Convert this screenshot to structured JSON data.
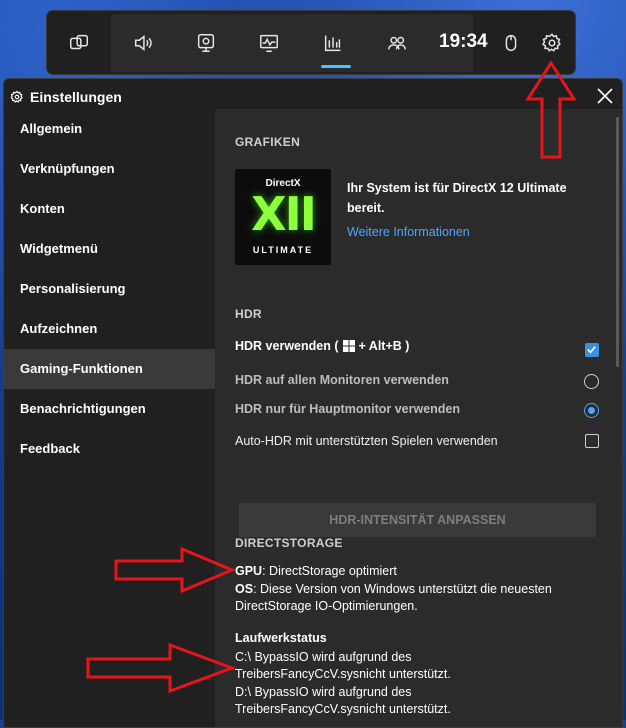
{
  "gamebar": {
    "clock": "19:34",
    "icons": [
      "widget-icon",
      "volume-icon",
      "capture-icon",
      "performance-icon",
      "resources-icon",
      "social-icon",
      "mouse-icon",
      "gear-icon"
    ]
  },
  "window": {
    "title": "Einstellungen",
    "close_label": "✕"
  },
  "nav": {
    "items": [
      "Allgemein",
      "Verknüpfungen",
      "Konten",
      "Widgetmenü",
      "Personalisierung",
      "Aufzeichnen",
      "Gaming-Funktionen",
      "Benachrichtigungen",
      "Feedback"
    ],
    "selected": "Gaming-Funktionen"
  },
  "graphics": {
    "heading": "GRAFIKEN",
    "logo_top": "DirectX",
    "logo_big": "XII",
    "logo_bottom": "ULTIMATE",
    "line1": "Ihr System ist für DirectX 12 Ultimate",
    "line2": "bereit.",
    "link": "Weitere Informationen"
  },
  "hdr": {
    "heading": "HDR",
    "use_hdr_label": "HDR verwenden (",
    "use_hdr_shortcut": "+ Alt+B )",
    "use_hdr_checked": true,
    "all_monitors_label": "HDR auf allen Monitoren verwenden",
    "all_monitors_selected": false,
    "main_monitor_label": "HDR nur für Hauptmonitor verwenden",
    "main_monitor_selected": true,
    "auto_hdr_label": "Auto-HDR mit unterstützten Spielen verwenden",
    "auto_hdr_checked": false,
    "intensity_button": "HDR-INTENSITÄT ANPASSEN"
  },
  "directstorage": {
    "heading": "DIRECTSTORAGE",
    "gpu_label": "GPU",
    "gpu_text": ": DirectStorage optimiert",
    "os_label": "OS",
    "os_text": ": Diese Version von Windows unterstützt die neuesten",
    "os_text2": "DirectStorage IO-Optimierungen.",
    "drive_heading": "Laufwerkstatus",
    "c_line1": "C:\\ BypassIO wird aufgrund des",
    "c_line2": "TreibersFancyCcV.sysnicht unterstützt.",
    "d_line1": "D:\\ BypassIO wird aufgrund des",
    "d_line2": "TreibersFancyCcV.sysnicht unterstützt."
  },
  "colors": {
    "accent": "#4ca6ff",
    "arrow": "#e8141b"
  }
}
